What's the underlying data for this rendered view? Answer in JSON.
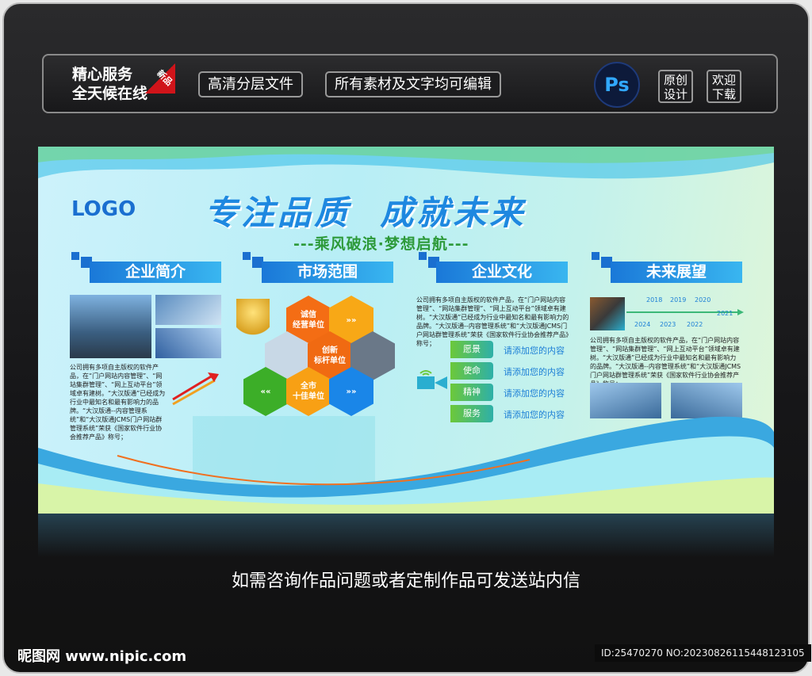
{
  "topbar": {
    "slogan_line1": "精心服务",
    "slogan_line2": "全天候在线",
    "new_tag": "新品",
    "pill1": "高清分层文件",
    "pill2": "所有素材及文字均可编辑",
    "ps_label": "Ps",
    "original_line1": "原创",
    "original_line2": "设计",
    "download_line1": "欢迎",
    "download_line2": "下载"
  },
  "board": {
    "logo": "LOGO",
    "title": "专注品质  成就未来",
    "subtitle": "---乘风破浪·梦想启航---",
    "sections": [
      {
        "title": "企业简介",
        "body": "公司拥有多项自主版权的软件产品，在“门户网站内容管理”、“网站集群管理”、“网上互动平台”领域卓有建树。“大汉版通”已经成为行业中最知名和最有影响力的品牌。“大汉版通--内容管理系统”和“大汉版通JCMS门户网站群管理系统”荣获《国家软件行业协会推荐产品》称号；"
      },
      {
        "title": "市场范围",
        "hexes": [
          "诚信\n经营单位",
          "创新\n标杆单位",
          "全市\n十佳单位"
        ]
      },
      {
        "title": "企业文化",
        "body": "公司拥有多项自主版权的软件产品，在“门户网站内容管理”、“网站集群管理”、“网上互动平台”领域卓有建树。“大汉版通”已经成为行业中最知名和最有影响力的品牌。“大汉版通--内容管理系统”和“大汉版通JCMS门户网站群管理系统”荣获《国家软件行业协会推荐产品》称号；",
        "items": [
          {
            "label": "愿景",
            "text": "请添加您的内容"
          },
          {
            "label": "使命",
            "text": "请添加您的内容"
          },
          {
            "label": "精神",
            "text": "请添加您的内容"
          },
          {
            "label": "服务",
            "text": "请添加您的内容"
          }
        ]
      },
      {
        "title": "未来展望",
        "years_top": [
          "2018",
          "2019",
          "2020"
        ],
        "year_end": "2021",
        "years_bottom": [
          "2024",
          "2023",
          "2022"
        ],
        "body": "公司拥有多项自主版权的软件产品，在“门户网站内容管理”、“网站集群管理”、“网上互动平台”领域卓有建树。“大汉版通”已经成为行业中最知名和最有影响力的品牌。“大汉版通--内容管理系统”和“大汉版通JCMS门户网站群管理系统”荣获《国家软件行业协会推荐产品》称号；"
      }
    ]
  },
  "caption": "如需咨询作品问题或者定制作品可发送站内信",
  "footer": {
    "site": "昵图网 www.nipic.com",
    "id": "ID:25470270 NO:20230826115448123105"
  }
}
